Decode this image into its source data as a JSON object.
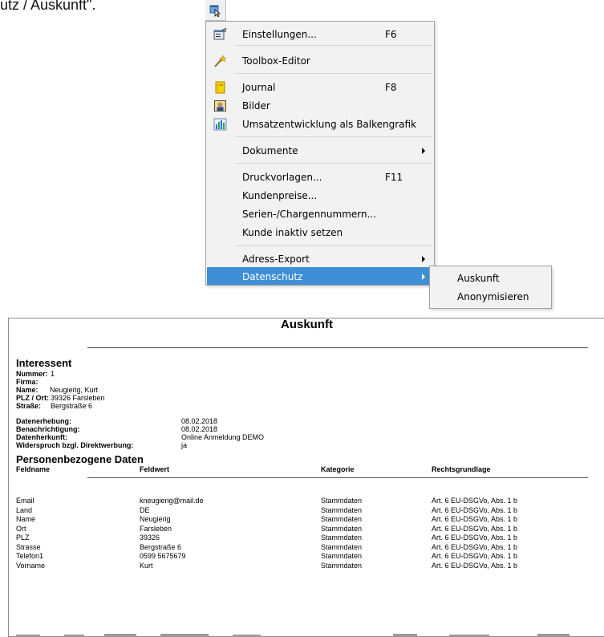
{
  "intro_text": "utz / Auskunft\".",
  "menu": {
    "items": [
      {
        "label": "Einstellungen...",
        "shortcut": "F6",
        "icon": "settings-icon"
      },
      {
        "label": "Toolbox-Editor",
        "shortcut": "",
        "icon": "magic-wand-icon"
      },
      {
        "label": "Journal",
        "shortcut": "F8",
        "icon": "journal-icon"
      },
      {
        "label": "Bilder",
        "shortcut": "",
        "icon": "picture-icon"
      },
      {
        "label": "Umsatzentwicklung als Balkengrafik",
        "shortcut": "",
        "icon": "bar-chart-icon"
      },
      {
        "label": "Dokumente",
        "shortcut": "",
        "icon": ""
      },
      {
        "label": "Druckvorlagen...",
        "shortcut": "F11",
        "icon": ""
      },
      {
        "label": "Kundenpreise...",
        "shortcut": "",
        "icon": ""
      },
      {
        "label": "Serien-/Chargennummern...",
        "shortcut": "",
        "icon": ""
      },
      {
        "label": "Kunde inaktiv setzen",
        "shortcut": "",
        "icon": ""
      },
      {
        "label": "Adress-Export",
        "shortcut": "",
        "icon": ""
      },
      {
        "label": "Datenschutz",
        "shortcut": "",
        "icon": "",
        "highlighted": true
      }
    ],
    "highlight_color": "#3f8fd6"
  },
  "submenu": {
    "items": [
      "Auskunft",
      "Anonymisieren"
    ]
  },
  "report": {
    "title": "Auskunft",
    "section1": "Interessent",
    "person": [
      {
        "label": "Nummer:",
        "value": "1"
      },
      {
        "label": "Firma:",
        "value": ""
      },
      {
        "label": "Name:",
        "value": "Neugierig, Kurt"
      },
      {
        "label": "PLZ / Ort:",
        "value": "39326 Farsleben"
      },
      {
        "label": "Straße:",
        "value": "Bergstraße 6"
      }
    ],
    "meta": [
      {
        "label": "Datenerhebung:",
        "value": "08.02.2018"
      },
      {
        "label": "Benachrichtigung:",
        "value": "08.02.2018"
      },
      {
        "label": "Datenherkunft:",
        "value": "Online Anmeldung DEMO"
      },
      {
        "label": "Widerspruch bzgl. Direktwerbung:",
        "value": "ja"
      }
    ],
    "section2": "Personenbezogene Daten",
    "columns": [
      "Feldname",
      "Feldwert",
      "Kategorie",
      "Rechtsgrundlage"
    ],
    "rows": [
      [
        "Email",
        "kneugierig@mail.de",
        "Stammdaten",
        "Art. 6 EU-DSGVo, Abs. 1 b"
      ],
      [
        "Land",
        "DE",
        "Stammdaten",
        "Art. 6 EU-DSGVo, Abs. 1 b"
      ],
      [
        "Name",
        "Neugierig",
        "Stammdaten",
        "Art. 6 EU-DSGVo, Abs. 1 b"
      ],
      [
        "Ort",
        "Farsleben",
        "Stammdaten",
        "Art. 6 EU-DSGVo, Abs. 1 b"
      ],
      [
        "PLZ",
        "39326",
        "Stammdaten",
        "Art. 6 EU-DSGVo, Abs. 1 b"
      ],
      [
        "Strasse",
        "Bergstraße 6",
        "Stammdaten",
        "Art. 6 EU-DSGVo, Abs. 1 b"
      ],
      [
        "Telefon1",
        "0599 5675679",
        "Stammdaten",
        "Art. 6 EU-DSGVo, Abs. 1 b"
      ],
      [
        "Vorname",
        "Kurt",
        "Stammdaten",
        "Art. 6 EU-DSGVo, Abs. 1 b"
      ]
    ]
  }
}
